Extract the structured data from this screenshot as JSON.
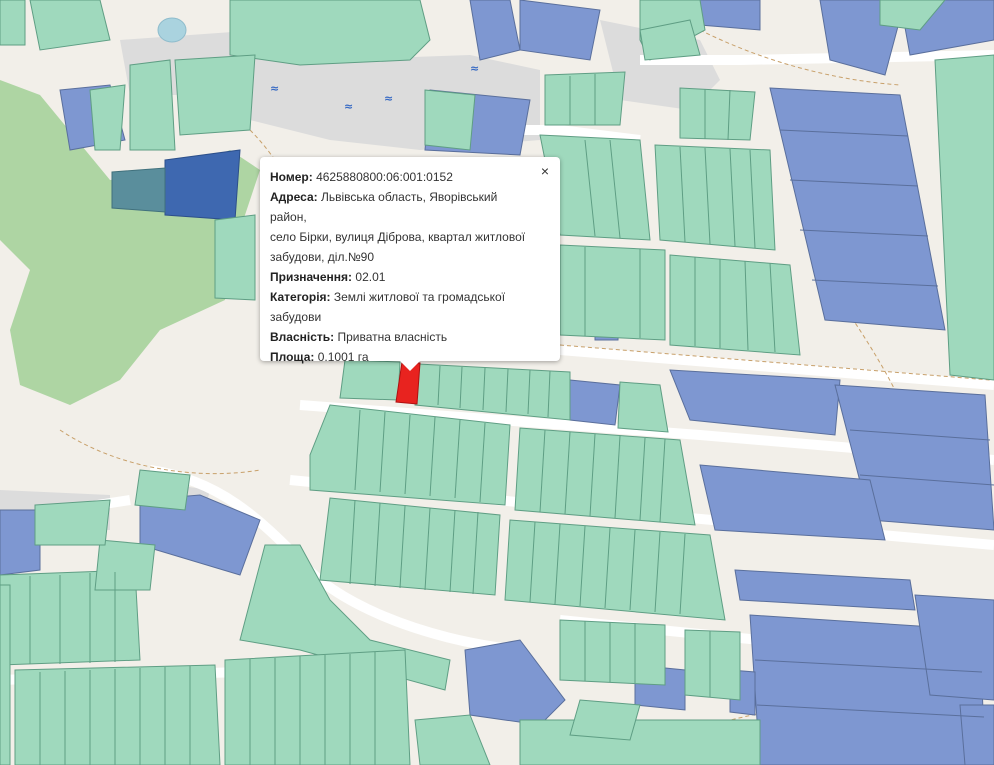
{
  "colors": {
    "private_parcel": "#9fd9bd",
    "public_parcel": "#7e97d1",
    "selected_parcel": "#e8231f",
    "forest": "#a6d29b",
    "road": "#ffffff",
    "built_area": "#d9d9d9",
    "background": "#f2efe9"
  },
  "popup": {
    "close_symbol": "×",
    "number_label": "Номер:",
    "number_value": "4625880800:06:001:0152",
    "address_label": "Адреса:",
    "address_value_line1": "Львівська область, Яворівський район,",
    "address_value_line2": "село Бірки, вулиця Діброва, квартал житлової",
    "address_value_line3": "забудови, діл.№90",
    "purpose_label": "Призначення:",
    "purpose_value": "02.01",
    "category_label": "Категорія:",
    "category_value_line1": "Землі житлової та громадської",
    "category_value_line2": "забудови",
    "ownership_label": "Власність:",
    "ownership_value": "Приватна власність",
    "area_label": "Площа:",
    "area_value": "0.1001 га"
  },
  "map": {
    "water_symbol": "≈"
  }
}
